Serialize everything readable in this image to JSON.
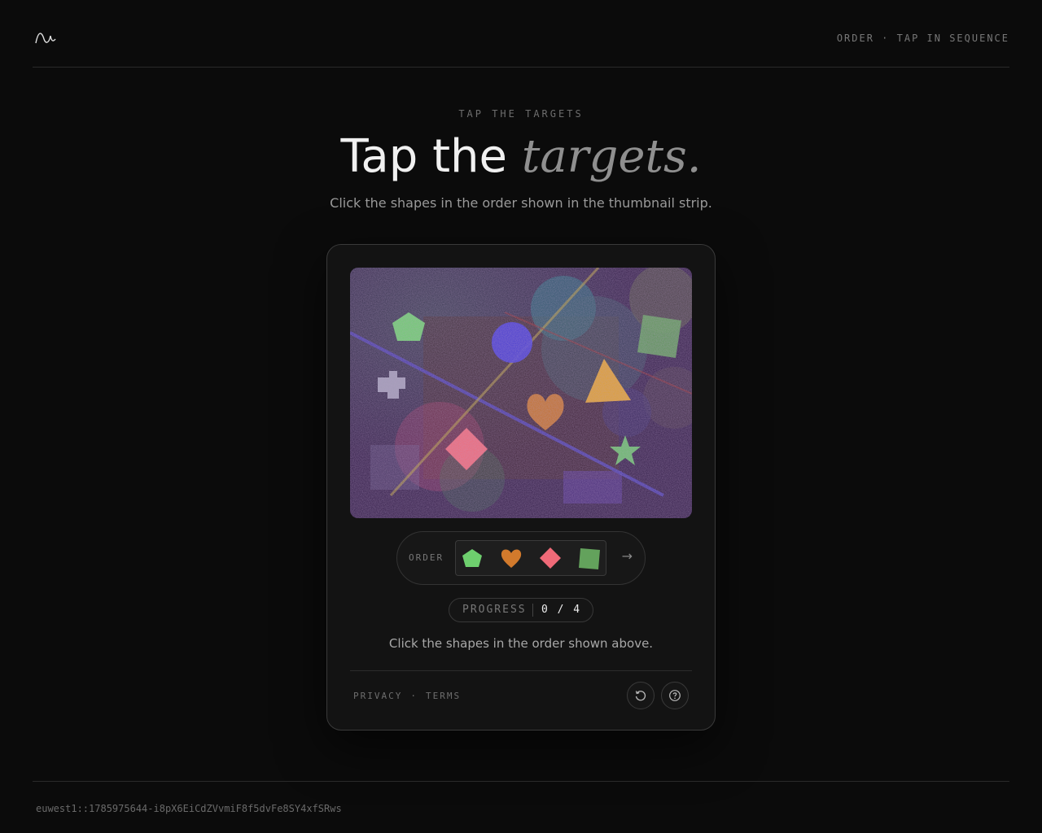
{
  "header": {
    "logo_icon": "wave-logo-icon",
    "right_text": "ORDER · TAP IN SEQUENCE"
  },
  "hero": {
    "eyebrow": "TAP THE TARGETS",
    "title_plain": "Tap the",
    "title_italic": "targets.",
    "subtitle": "Click the shapes in the order shown in the thumbnail strip."
  },
  "challenge": {
    "canvas_icon": "captcha-shapes-canvas",
    "order_label": "ORDER",
    "order_thumbnails": [
      {
        "shape": "pentagon",
        "color": "#6ecf6e"
      },
      {
        "shape": "heart",
        "color": "#d27a2c"
      },
      {
        "shape": "diamond",
        "color": "#f06a78"
      },
      {
        "shape": "square",
        "color": "#63a25c"
      }
    ],
    "next_icon": "arrow-right-icon",
    "progress_label": "PROGRESS",
    "progress_value": "0 / 4",
    "progress_current": 0,
    "progress_total": 4,
    "instruction": "Click the shapes in the order shown above.",
    "footer_links": [
      "PRIVACY",
      "TERMS"
    ],
    "reload_icon": "reload-icon",
    "help_icon": "help-icon"
  },
  "footer": {
    "session_id": "euwest1::1785975644-i8pX6EiCdZVvmiF8f5dvFe8SY4xfSRws"
  },
  "colors": {
    "background": "#0b0b0b",
    "card": "#131313",
    "canvas_base": "#3a2348"
  }
}
